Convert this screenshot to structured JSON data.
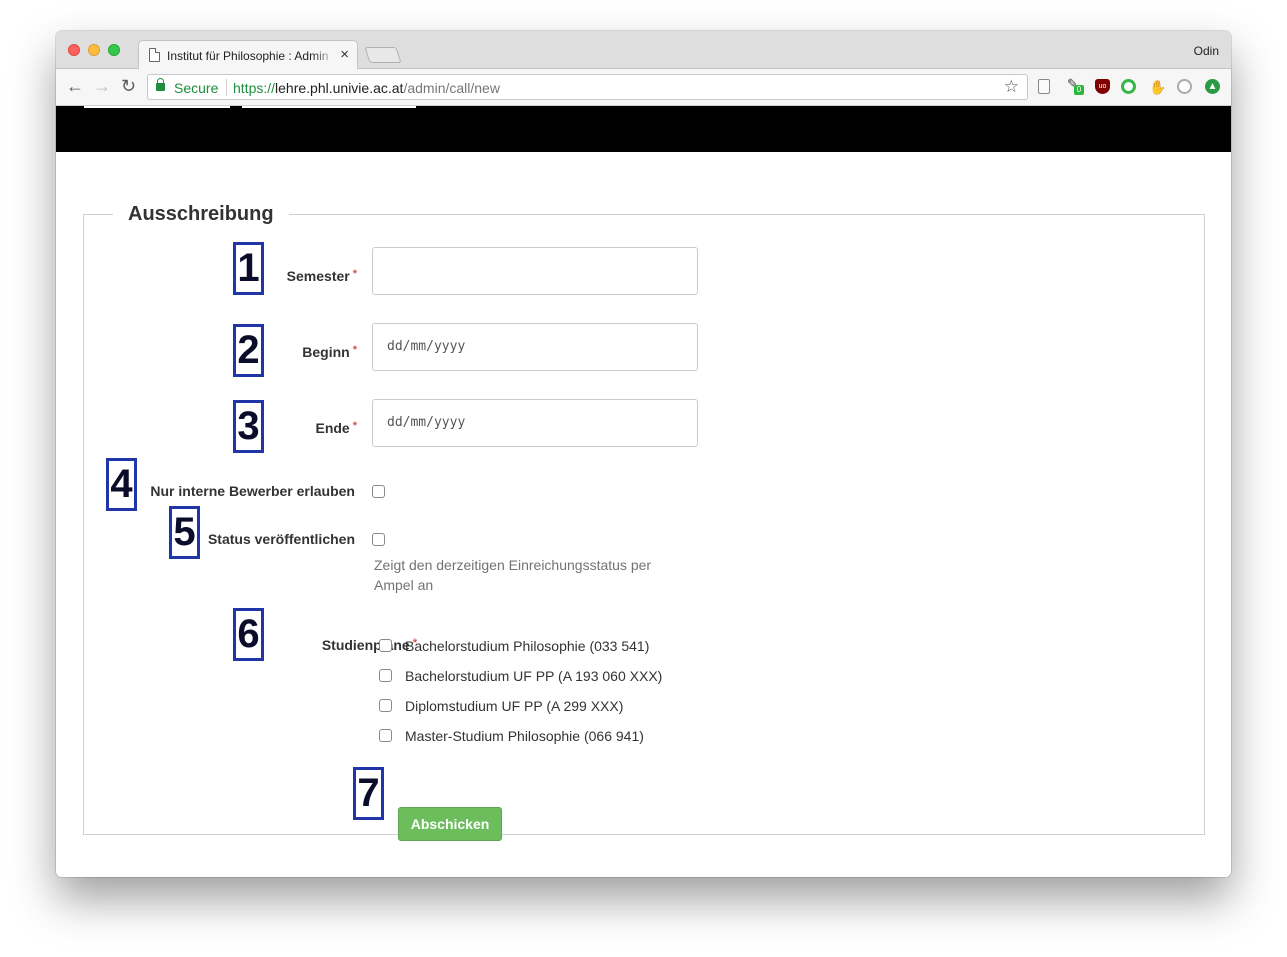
{
  "browser": {
    "tab_title": "Institut für Philosophie : Admin",
    "tab_close": "×",
    "profile_name": "Odin",
    "secure_label": "Secure",
    "url_protocol": "https://",
    "url_host": "lehre.phl.univie.ac.at",
    "url_path": "/admin/call/new",
    "back": "←",
    "forward": "→",
    "reload": "↻",
    "star": "☆",
    "ext_ublock": "uo",
    "ext_badge_count": "0"
  },
  "form": {
    "legend": "Ausschreibung",
    "semester_label": "Semester",
    "semester_value": "",
    "beginn_label": "Beginn",
    "beginn_placeholder": "dd/mm/yyyy",
    "ende_label": "Ende",
    "ende_placeholder": "dd/mm/yyyy",
    "interne_label": "Nur interne Bewerber erlauben",
    "status_label": "Status veröffentlichen",
    "status_help": "Zeigt den derzeitigen Einreichungsstatus per Ampel an",
    "studienplaene_label": "Studienpläne",
    "required_mark": "*",
    "studienplaene_options": [
      "Bachelorstudium Philosophie (033 541)",
      "Bachelorstudium UF PP (A 193 060 XXX)",
      "Diplomstudium UF PP (A 299 XXX)",
      "Master-Studium Philosophie (066 941)"
    ],
    "submit_label": "Abschicken"
  },
  "annotations": [
    "1",
    "2",
    "3",
    "4",
    "5",
    "6",
    "7"
  ],
  "colors": {
    "marker_border": "#1f35a8",
    "submit_bg": "#6cbe5d",
    "required": "#d9534f",
    "secure": "#1e8e3e"
  }
}
